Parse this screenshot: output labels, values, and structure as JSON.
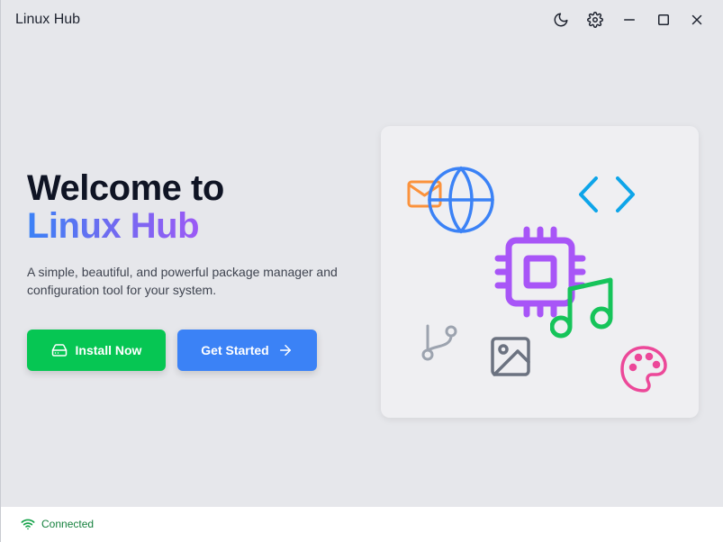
{
  "window": {
    "title": "Linux Hub"
  },
  "titlebar": {
    "icons": [
      "moon-icon",
      "gear-icon",
      "minimize-icon",
      "maximize-icon",
      "close-icon"
    ]
  },
  "hero": {
    "title_line1": "Welcome to",
    "title_line2": "Linux Hub",
    "subtitle": "A simple, beautiful, and powerful package manager and configuration tool for your system."
  },
  "buttons": {
    "install_label": "Install Now",
    "start_label": "Get Started"
  },
  "illustration": {
    "icons": [
      "mail-icon",
      "globe-icon",
      "code-icon",
      "cpu-icon",
      "music-icon",
      "git-branch-icon",
      "image-icon",
      "palette-icon"
    ]
  },
  "status": {
    "text": "Connected"
  },
  "colors": {
    "install_green": "#06c653",
    "start_blue": "#3b82f6",
    "title_gradient_start": "#3b82f6",
    "title_gradient_end": "#a855f7",
    "status_green": "#15803d"
  }
}
